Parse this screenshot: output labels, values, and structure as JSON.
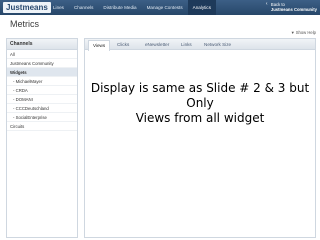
{
  "topbar": {
    "logo": "Justmeans",
    "nav": [
      "Lines",
      "Channels",
      "Distribute Media",
      "Manage Contests",
      "Analytics"
    ],
    "active_nav": "Analytics",
    "back_line1": "Back to",
    "back_line2": "Justmeans Community"
  },
  "header": {
    "title": "Metrics",
    "show_help": "Show Help"
  },
  "sidebar": {
    "title": "Channels",
    "items": [
      {
        "label": "All",
        "sub": false,
        "active": false
      },
      {
        "label": "Justmeans Community",
        "sub": false,
        "active": false
      },
      {
        "label": "Widgets",
        "sub": false,
        "active": true
      },
      {
        "label": "- MichaelMayer",
        "sub": true,
        "active": false
      },
      {
        "label": "- CRDA",
        "sub": true,
        "active": false
      },
      {
        "label": "- DOMANI",
        "sub": true,
        "active": false
      },
      {
        "label": "- CCCDeutschland",
        "sub": true,
        "active": false
      },
      {
        "label": "- SocialEnterprise",
        "sub": true,
        "active": false
      },
      {
        "label": "Circuits",
        "sub": false,
        "active": false
      }
    ]
  },
  "main": {
    "tabs": [
      "Views",
      "Clicks",
      "eNewsletter",
      "Links",
      "Network Size"
    ],
    "active_tab": "Views",
    "overlay_line1": "Display is same as Slide # 2 & 3 but",
    "overlay_line2": "Only",
    "overlay_line3": "Views from all widget"
  }
}
